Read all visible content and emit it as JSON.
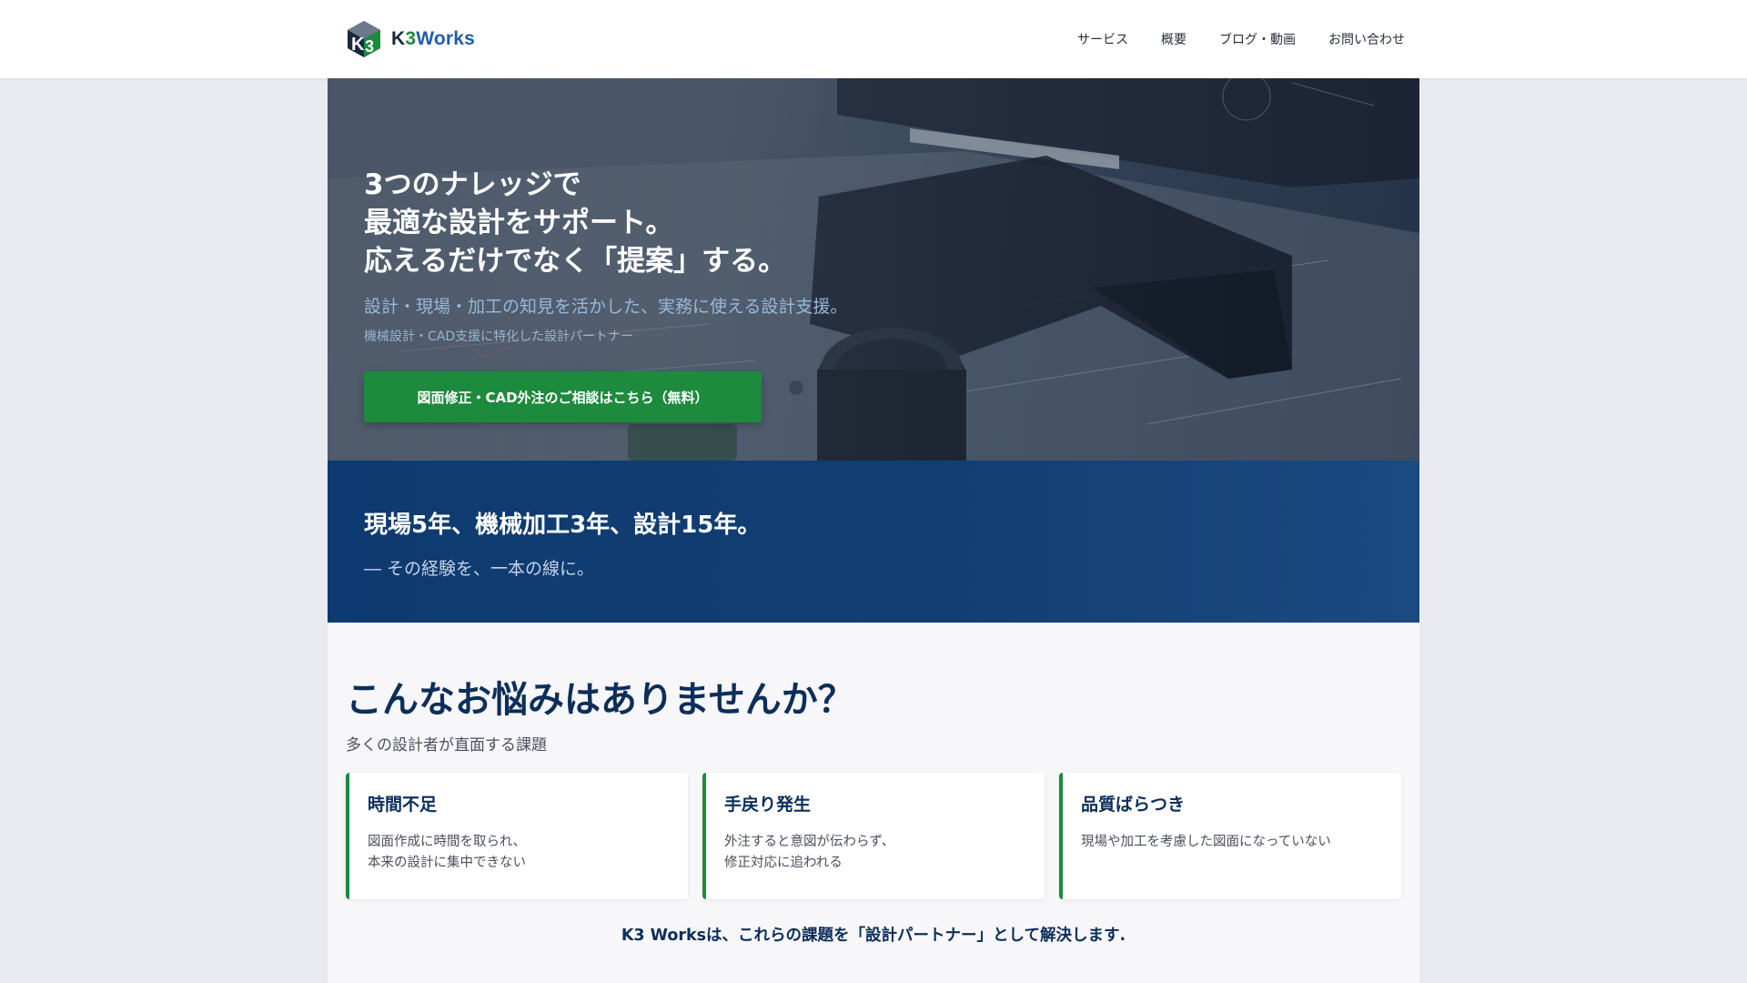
{
  "brand": {
    "logo_text_k": "K",
    "logo_text_3": "3",
    "logo_text_works": "Works",
    "colors": {
      "navy": "#0c2e5a",
      "green": "#1e8a3e",
      "blue": "#1f5ea8"
    }
  },
  "nav": {
    "items": [
      {
        "label": "サービス"
      },
      {
        "label": "概要"
      },
      {
        "label": "ブログ・動画"
      },
      {
        "label": "お問い合わせ"
      }
    ]
  },
  "hero": {
    "title_line1": "3つのナレッジで",
    "title_line2": "最適な設計をサポート。",
    "title_line3": "応えるだけでなく「提案」する。",
    "subtitle": "設計・現場・加工の知見を活かした、実務に使える設計支援。",
    "tagline": "機械設計・CAD支援に特化した設計パートナー",
    "cta_label": "図面修正・CAD外注のご相談はこちら（無料）"
  },
  "experience": {
    "title": "現場5年、機械加工3年、設計15年。",
    "subtitle": "― その経験を、一本の線に。"
  },
  "problems": {
    "title": "こんなお悩みはありませんか？",
    "subtitle": "多くの設計者が直面する課題",
    "cards": [
      {
        "title": "時間不足",
        "desc": "図面作成に時間を取られ、\n本来の設計に集中できない"
      },
      {
        "title": "手戻り発生",
        "desc": "外注すると意図が伝わらず、\n修正対応に追われる"
      },
      {
        "title": "品質ばらつき",
        "desc": "現場や加工を考慮した図面になっていない"
      }
    ],
    "closing": "K3 Worksは、これらの課題を「設計パートナー」として解決します."
  }
}
